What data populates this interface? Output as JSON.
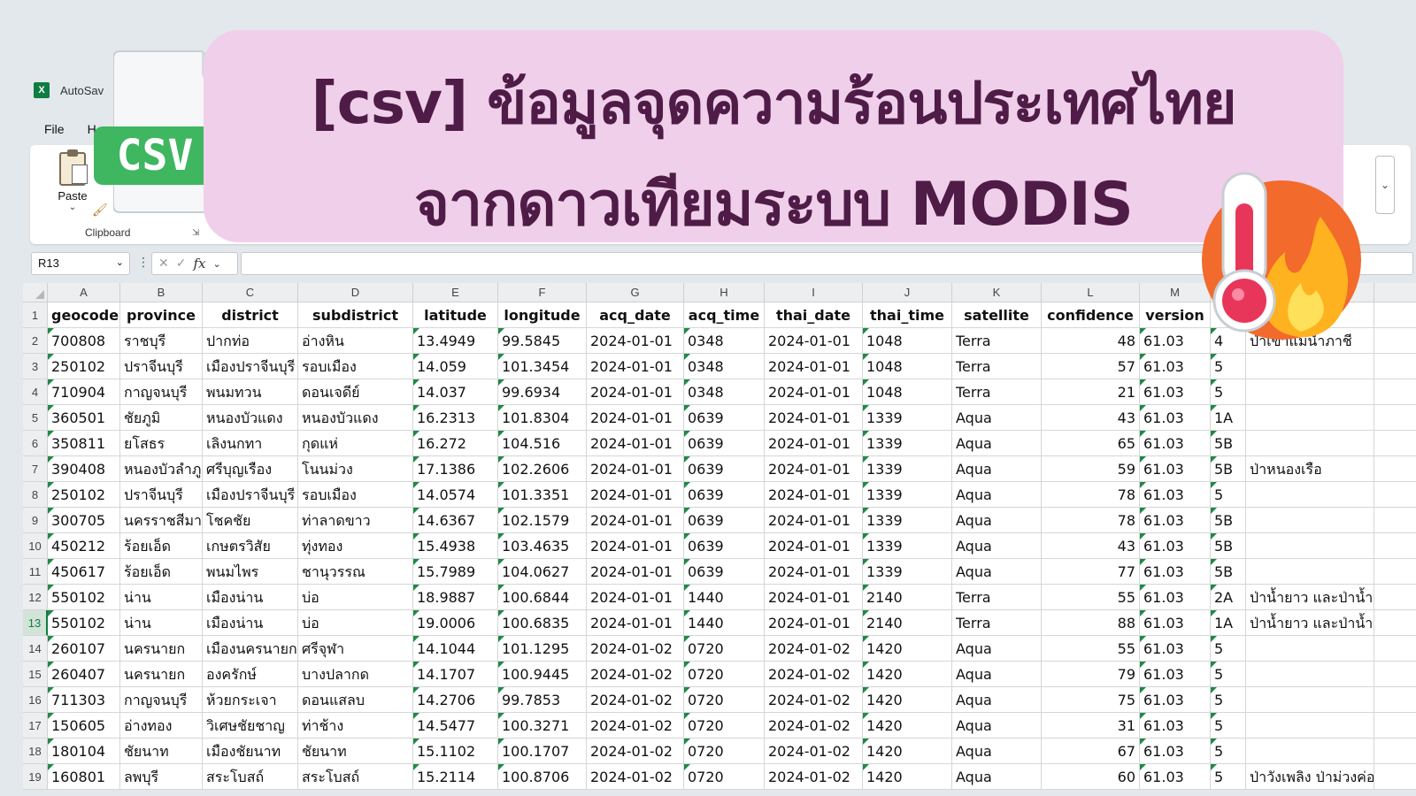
{
  "app": {
    "autosave_label": "AutoSav",
    "excel_icon": "X"
  },
  "menu": {
    "file": "File",
    "home_partial": "H"
  },
  "ribbon": {
    "paste_label": "Paste",
    "clipboard_label": "Clipboard"
  },
  "formula_bar": {
    "name_box": "R13",
    "fx": "fx"
  },
  "banner": {
    "line1": "[csv] ข้อมูลจุดความร้อนประเทศไทย",
    "line2": "จากดาวเทียมระบบ MODIS",
    "badge": "CSV",
    "badge_color": "#3fb660",
    "bg_color": "#f0cfea",
    "text_color": "#4e1c47",
    "icons": [
      "csv-file-icon",
      "thermometer-fire-icon"
    ]
  },
  "sheet": {
    "selected_row": "13",
    "columns": [
      {
        "letter": "A",
        "header": "geocode"
      },
      {
        "letter": "B",
        "header": "province"
      },
      {
        "letter": "C",
        "header": "district"
      },
      {
        "letter": "D",
        "header": "subdistrict"
      },
      {
        "letter": "E",
        "header": "latitude"
      },
      {
        "letter": "F",
        "header": "longitude"
      },
      {
        "letter": "G",
        "header": "acq_date"
      },
      {
        "letter": "H",
        "header": "acq_time"
      },
      {
        "letter": "I",
        "header": "thai_date"
      },
      {
        "letter": "J",
        "header": "thai_time"
      },
      {
        "letter": "K",
        "header": "satellite"
      },
      {
        "letter": "L",
        "header": "confidence"
      },
      {
        "letter": "M",
        "header": "version"
      },
      {
        "letter": "",
        "header": ""
      },
      {
        "letter": "",
        "header": "e"
      },
      {
        "letter": "",
        "header": ""
      }
    ],
    "rows": [
      {
        "n": "2",
        "cells": [
          "700808",
          "ราชบุรี",
          "ปากท่อ",
          "อ่างหิน",
          "13.4949",
          "99.5845",
          "2024-01-01",
          "0348",
          "2024-01-01",
          "1048",
          "Terra",
          "48",
          "61.03",
          "4",
          "ป่าเขาแม่น้ำภาชี",
          ""
        ]
      },
      {
        "n": "3",
        "cells": [
          "250102",
          "ปราจีนบุรี",
          "เมืองปราจีนบุรี",
          "รอบเมือง",
          "14.059",
          "101.3454",
          "2024-01-01",
          "0348",
          "2024-01-01",
          "1048",
          "Terra",
          "57",
          "61.03",
          "5",
          "",
          ""
        ]
      },
      {
        "n": "4",
        "cells": [
          "710904",
          "กาญจนบุรี",
          "พนมทวน",
          "ดอนเจดีย์",
          "14.037",
          "99.6934",
          "2024-01-01",
          "0348",
          "2024-01-01",
          "1048",
          "Terra",
          "21",
          "61.03",
          "5",
          "",
          ""
        ]
      },
      {
        "n": "5",
        "cells": [
          "360501",
          "ชัยภูมิ",
          "หนองบัวแดง",
          "หนองบัวแดง",
          "16.2313",
          "101.8304",
          "2024-01-01",
          "0639",
          "2024-01-01",
          "1339",
          "Aqua",
          "43",
          "61.03",
          "1A",
          "",
          ""
        ]
      },
      {
        "n": "6",
        "cells": [
          "350811",
          "ยโสธร",
          "เลิงนกทา",
          "กุดแห่",
          "16.272",
          "104.516",
          "2024-01-01",
          "0639",
          "2024-01-01",
          "1339",
          "Aqua",
          "65",
          "61.03",
          "5B",
          "",
          ""
        ]
      },
      {
        "n": "7",
        "cells": [
          "390408",
          "หนองบัวลำภู",
          "ศรีบุญเรือง",
          "โนนม่วง",
          "17.1386",
          "102.2606",
          "2024-01-01",
          "0639",
          "2024-01-01",
          "1339",
          "Aqua",
          "59",
          "61.03",
          "5B",
          "ป่าหนองเรือ",
          ""
        ]
      },
      {
        "n": "8",
        "cells": [
          "250102",
          "ปราจีนบุรี",
          "เมืองปราจีนบุรี",
          "รอบเมือง",
          "14.0574",
          "101.3351",
          "2024-01-01",
          "0639",
          "2024-01-01",
          "1339",
          "Aqua",
          "78",
          "61.03",
          "5",
          "",
          ""
        ]
      },
      {
        "n": "9",
        "cells": [
          "300705",
          "นครราชสีมา",
          "โชคชัย",
          "ท่าลาดขาว",
          "14.6367",
          "102.1579",
          "2024-01-01",
          "0639",
          "2024-01-01",
          "1339",
          "Aqua",
          "78",
          "61.03",
          "5B",
          "",
          ""
        ]
      },
      {
        "n": "10",
        "cells": [
          "450212",
          "ร้อยเอ็ด",
          "เกษตรวิสัย",
          "ทุ่งทอง",
          "15.4938",
          "103.4635",
          "2024-01-01",
          "0639",
          "2024-01-01",
          "1339",
          "Aqua",
          "43",
          "61.03",
          "5B",
          "",
          ""
        ]
      },
      {
        "n": "11",
        "cells": [
          "450617",
          "ร้อยเอ็ด",
          "พนมไพร",
          "ชานุวรรณ",
          "15.7989",
          "104.0627",
          "2024-01-01",
          "0639",
          "2024-01-01",
          "1339",
          "Aqua",
          "77",
          "61.03",
          "5B",
          "",
          ""
        ]
      },
      {
        "n": "12",
        "cells": [
          "550102",
          "น่าน",
          "เมืองน่าน",
          "บ่อ",
          "18.9887",
          "100.6844",
          "2024-01-01",
          "1440",
          "2024-01-01",
          "2140",
          "Terra",
          "55",
          "61.03",
          "2A",
          "ป่าน้ำยาว และป่าน้ำสวด",
          ""
        ]
      },
      {
        "n": "13",
        "cells": [
          "550102",
          "น่าน",
          "เมืองน่าน",
          "บ่อ",
          "19.0006",
          "100.6835",
          "2024-01-01",
          "1440",
          "2024-01-01",
          "2140",
          "Terra",
          "88",
          "61.03",
          "1A",
          "ป่าน้ำยาว และป่าน้ำสวด",
          ""
        ]
      },
      {
        "n": "14",
        "cells": [
          "260107",
          "นครนายก",
          "เมืองนครนายก",
          "ศรีจุฬา",
          "14.1044",
          "101.1295",
          "2024-01-02",
          "0720",
          "2024-01-02",
          "1420",
          "Aqua",
          "55",
          "61.03",
          "5",
          "",
          ""
        ]
      },
      {
        "n": "15",
        "cells": [
          "260407",
          "นครนายก",
          "องครักษ์",
          "บางปลากด",
          "14.1707",
          "100.9445",
          "2024-01-02",
          "0720",
          "2024-01-02",
          "1420",
          "Aqua",
          "79",
          "61.03",
          "5",
          "",
          ""
        ]
      },
      {
        "n": "16",
        "cells": [
          "711303",
          "กาญจนบุรี",
          "ห้วยกระเจา",
          "ดอนแสลบ",
          "14.2706",
          "99.7853",
          "2024-01-02",
          "0720",
          "2024-01-02",
          "1420",
          "Aqua",
          "75",
          "61.03",
          "5",
          "",
          ""
        ]
      },
      {
        "n": "17",
        "cells": [
          "150605",
          "อ่างทอง",
          "วิเศษชัยชาญ",
          "ท่าช้าง",
          "14.5477",
          "100.3271",
          "2024-01-02",
          "0720",
          "2024-01-02",
          "1420",
          "Aqua",
          "31",
          "61.03",
          "5",
          "",
          ""
        ]
      },
      {
        "n": "18",
        "cells": [
          "180104",
          "ชัยนาท",
          "เมืองชัยนาท",
          "ชัยนาท",
          "15.1102",
          "100.1707",
          "2024-01-02",
          "0720",
          "2024-01-02",
          "1420",
          "Aqua",
          "67",
          "61.03",
          "5",
          "",
          ""
        ]
      },
      {
        "n": "19",
        "cells": [
          "160801",
          "ลพบุรี",
          "สระโบสถ์",
          "สระโบสถ์",
          "15.2114",
          "100.8706",
          "2024-01-02",
          "0720",
          "2024-01-02",
          "1420",
          "Aqua",
          "60",
          "61.03",
          "5",
          "ป่าวังเพลิง ป่าม่วงค่อมแ",
          ""
        ]
      }
    ]
  }
}
